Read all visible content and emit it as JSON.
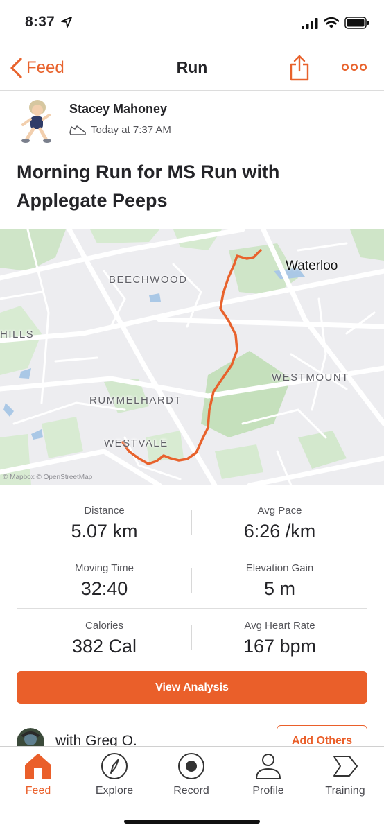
{
  "status_bar": {
    "time": "8:37"
  },
  "nav": {
    "back_label": "Feed",
    "title": "Run"
  },
  "athlete": {
    "name": "Stacey Mahoney",
    "time": "Today at 7:37 AM"
  },
  "activity": {
    "title": "Morning Run for MS Run with Applegate Peeps"
  },
  "map": {
    "labels": {
      "beechwood": "BEECHWOOD",
      "hills": "HILLS",
      "westmount": "WESTMOUNT",
      "rummelhardt": "RUMMELHARDT",
      "westvale": "WESTVALE"
    },
    "city": "Waterloo",
    "attribution": "© Mapbox  © OpenStreetMap",
    "route_color": "#e8622c"
  },
  "stats": [
    {
      "left": {
        "label": "Distance",
        "value": "5.07 km"
      },
      "right": {
        "label": "Avg Pace",
        "value": "6:26 /km"
      }
    },
    {
      "left": {
        "label": "Moving Time",
        "value": "32:40"
      },
      "right": {
        "label": "Elevation Gain",
        "value": "5 m"
      }
    },
    {
      "left": {
        "label": "Calories",
        "value": "382 Cal"
      },
      "right": {
        "label": "Avg Heart Rate",
        "value": "167 bpm"
      }
    }
  ],
  "actions": {
    "view_analysis": "View Analysis",
    "add_others": "Add Others"
  },
  "with": {
    "text": "with Greg O."
  },
  "tabs": [
    {
      "label": "Feed",
      "icon": "home-icon",
      "active": true
    },
    {
      "label": "Explore",
      "icon": "compass-icon",
      "active": false
    },
    {
      "label": "Record",
      "icon": "record-icon",
      "active": false
    },
    {
      "label": "Profile",
      "icon": "person-icon",
      "active": false
    },
    {
      "label": "Training",
      "icon": "training-icon",
      "active": false
    }
  ],
  "colors": {
    "accent": "#ea5f2a",
    "map_green": "#cfe5c8",
    "map_water": "#aac8e6"
  }
}
